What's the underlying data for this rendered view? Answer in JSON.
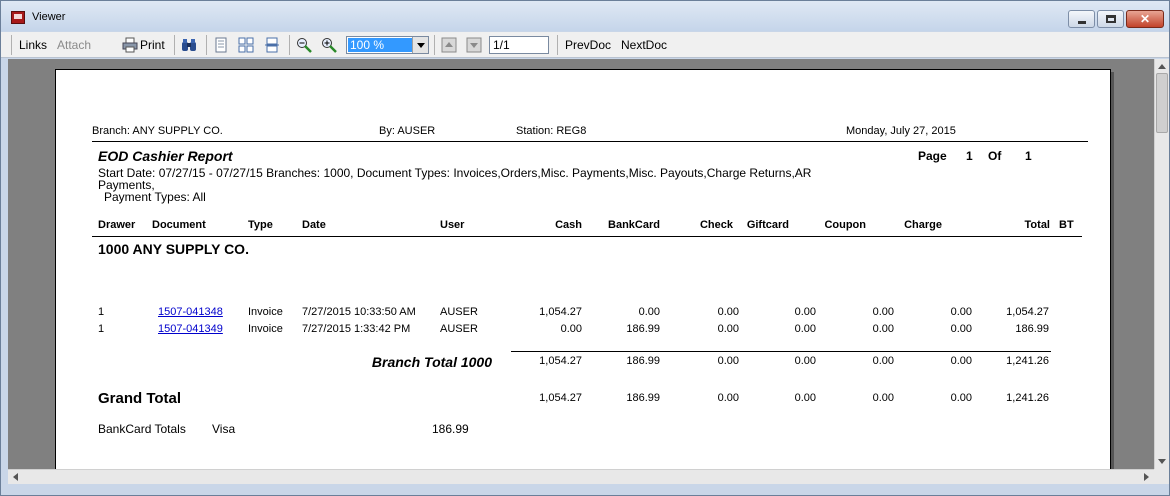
{
  "window": {
    "title": "Viewer"
  },
  "toolbar": {
    "links": "Links",
    "attach": "Attach",
    "print": "Print",
    "zoom": "100 %",
    "page": "1/1",
    "prev_doc": "PrevDoc",
    "next_doc": "NextDoc"
  },
  "report": {
    "header": {
      "branch": "Branch: ANY SUPPLY CO.",
      "by": "By: AUSER",
      "station": "Station: REG8",
      "date": "Monday, July 27, 2015"
    },
    "title": "EOD Cashier Report",
    "page_label": "Page",
    "page_num": "1",
    "of_label": "Of",
    "page_total": "1",
    "criteria_line1": "Start Date: 07/27/15   - 07/27/15  Branches: 1000,  Document Types: Invoices,Orders,Misc. Payments,Misc. Payouts,Charge Returns,AR",
    "criteria_line2": "Payments,",
    "criteria_line3": "Payment Types: All",
    "columns": {
      "drawer": "Drawer",
      "document": "Document",
      "type": "Type",
      "date": "Date",
      "user": "User",
      "cash": "Cash",
      "bankcard": "BankCard",
      "check": "Check",
      "giftcard": "Giftcard",
      "coupon": "Coupon",
      "charge": "Charge",
      "total": "Total",
      "bt": "BT"
    },
    "branch_heading": "1000 ANY SUPPLY CO.",
    "rows": [
      {
        "drawer": "1",
        "document": "1507-041348",
        "type": "Invoice",
        "date": "7/27/2015 10:33:50 AM",
        "user": "AUSER",
        "cash": "1,054.27",
        "bankcard": "0.00",
        "check": "0.00",
        "giftcard": "0.00",
        "coupon": "0.00",
        "charge": "0.00",
        "total": "1,054.27"
      },
      {
        "drawer": "1",
        "document": "1507-041349",
        "type": "Invoice",
        "date": "7/27/2015 1:33:42 PM",
        "user": "AUSER",
        "cash": "0.00",
        "bankcard": "186.99",
        "check": "0.00",
        "giftcard": "0.00",
        "coupon": "0.00",
        "charge": "0.00",
        "total": "186.99"
      }
    ],
    "branch_total": {
      "label": "Branch Total 1000",
      "cash": "1,054.27",
      "bankcard": "186.99",
      "check": "0.00",
      "giftcard": "0.00",
      "coupon": "0.00",
      "charge": "0.00",
      "total": "1,241.26"
    },
    "grand_total": {
      "label": "Grand Total",
      "cash": "1,054.27",
      "bankcard": "186.99",
      "check": "0.00",
      "giftcard": "0.00",
      "coupon": "0.00",
      "charge": "0.00",
      "total": "1,241.26"
    },
    "bankcard_totals": {
      "label": "BankCard Totals",
      "type": "Visa",
      "amount": "186.99"
    }
  }
}
